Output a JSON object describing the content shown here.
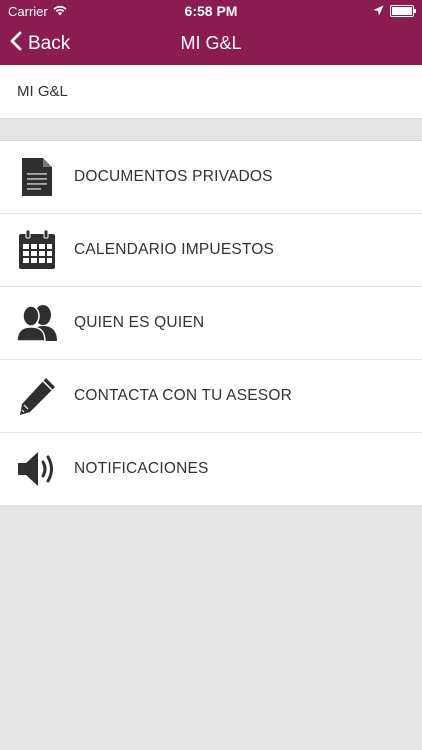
{
  "status_bar": {
    "carrier": "Carrier",
    "time": "6:58 PM",
    "wifi_icon": "wifi-icon",
    "location_icon": "location-arrow-icon",
    "battery_icon": "battery-icon"
  },
  "nav": {
    "back_label": "Back",
    "title": "MI G&L"
  },
  "section_header": "MI G&L",
  "menu": {
    "items": [
      {
        "label": "DOCUMENTOS PRIVADOS",
        "icon": "document-icon"
      },
      {
        "label": "CALENDARIO IMPUESTOS",
        "icon": "calendar-icon"
      },
      {
        "label": "QUIEN ES QUIEN",
        "icon": "people-icon"
      },
      {
        "label": "CONTACTA CON TU ASESOR",
        "icon": "pencil-icon"
      },
      {
        "label": "NOTIFICACIONES",
        "icon": "speaker-icon"
      }
    ]
  },
  "colors": {
    "brand": "#8a1c4f",
    "icon": "#2f2f2f",
    "background": "#e5e5e5"
  }
}
